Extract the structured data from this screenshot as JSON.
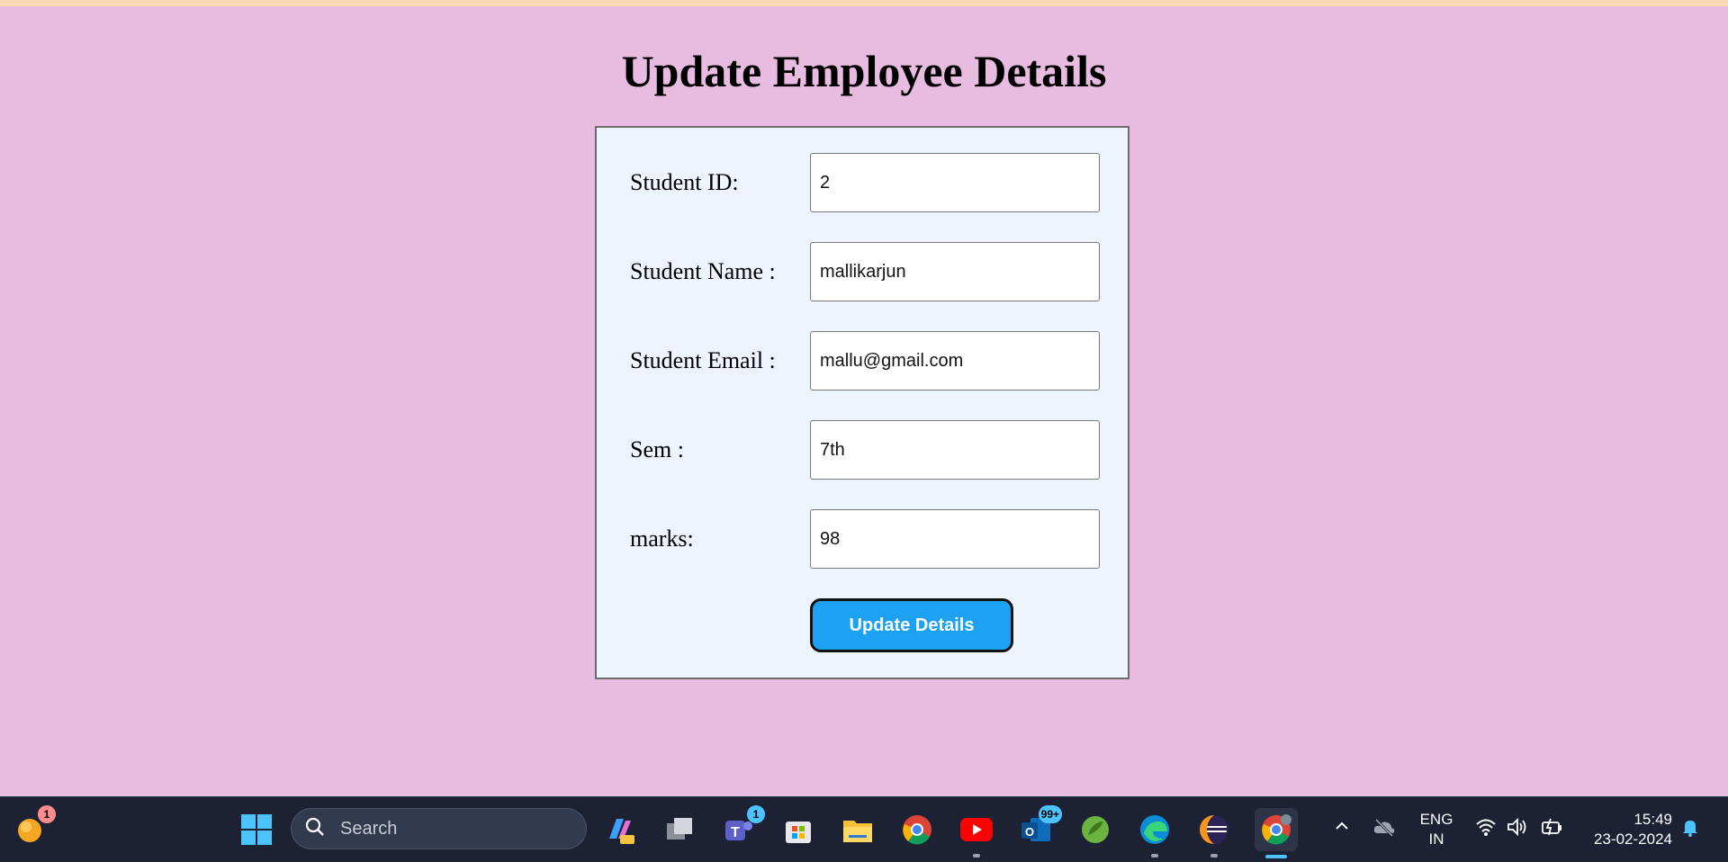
{
  "page": {
    "title": "Update Employee Details"
  },
  "form": {
    "fields": [
      {
        "label": "Student ID:",
        "value": "2"
      },
      {
        "label": "Student Name :",
        "value": "mallikarjun"
      },
      {
        "label": "Student Email :",
        "value": "mallu@gmail.com"
      },
      {
        "label": "Sem :",
        "value": "7th"
      },
      {
        "label": "marks:",
        "value": "98"
      }
    ],
    "submit_label": "Update Details"
  },
  "taskbar": {
    "notification_badge": "1",
    "search_placeholder": "Search",
    "teams_badge": "1",
    "outlook_badge": "99+",
    "language": "ENG",
    "region": "IN",
    "time": "15:49",
    "date": "23-02-2024"
  },
  "colors": {
    "page_background": "#e8bce0",
    "form_background": "#eef4fe",
    "button": "#1da1f2",
    "taskbar": "#1c2233"
  }
}
